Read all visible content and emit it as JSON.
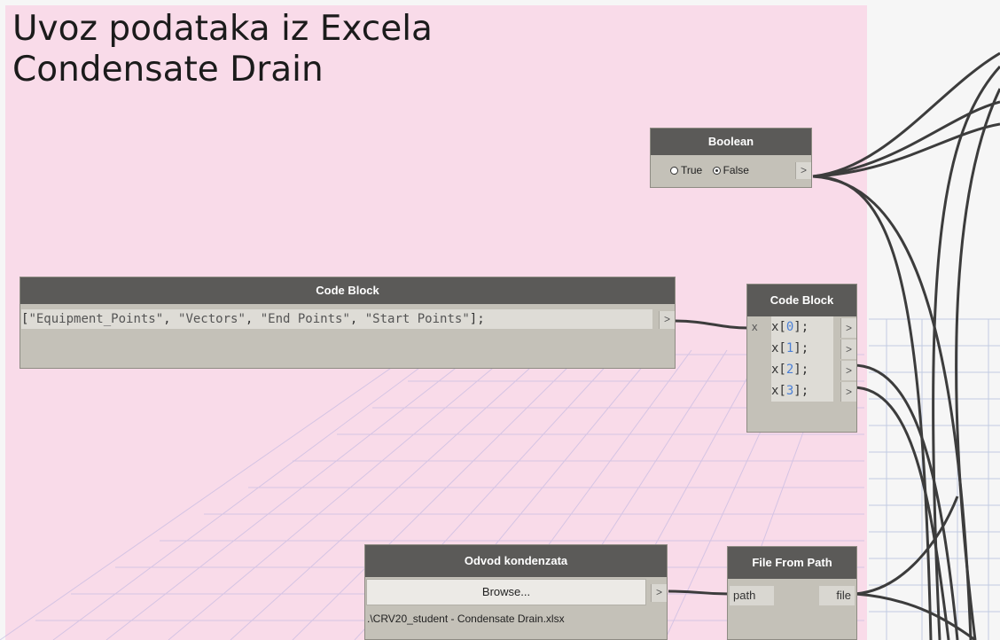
{
  "group": {
    "title_line1": "Uvoz podataka iz Excela",
    "title_line2": "Condensate Drain",
    "color": "#f9dbe9"
  },
  "nodes": {
    "boolean": {
      "title": "Boolean",
      "true_label": "True",
      "false_label": "False",
      "selected": "False",
      "out_port": ">"
    },
    "code_block_list": {
      "title": "Code Block",
      "code": [
        "\"Equipment_Points\"",
        "\"Vectors\"",
        "\"End Points\"",
        "\"Start Points\""
      ],
      "out_port": ">"
    },
    "code_block_index": {
      "title": "Code Block",
      "in_port": "x",
      "lines": [
        "x[0];",
        "x[1];",
        "x[2];",
        "x[3];"
      ],
      "index_values": [
        "0",
        "1",
        "2",
        "3"
      ],
      "out_port": ">"
    },
    "file_browse": {
      "title": "Odvod kondenzata",
      "button_label": "Browse...",
      "out_port": ">",
      "path_value": ".\\CRV20_student - Condensate Drain.xlsx"
    },
    "file_from_path": {
      "title": "File From Path",
      "in_port": "path",
      "out_port": "file"
    }
  },
  "colors": {
    "node_header": "#5b5a58",
    "node_body": "#c4c1b8",
    "wire": "#3c3c3c",
    "index_number": "#4a7fd6"
  }
}
